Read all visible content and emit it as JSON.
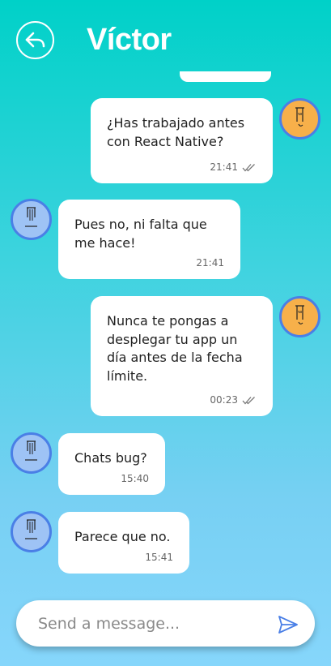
{
  "header": {
    "title": "Víctor",
    "back_icon": "back-arrow-icon"
  },
  "colors": {
    "accent": "#4a7fe6",
    "me_avatar": "#f7b04a",
    "them_avatar": "#9ec3f5"
  },
  "messages": [
    {
      "from": "me",
      "text": "¿Has trabajado antes\ncon React Native?",
      "time": "21:41",
      "status": "double-check"
    },
    {
      "from": "them",
      "text": "Pues no, ni falta que\nme hace!",
      "time": "21:41"
    },
    {
      "from": "me",
      "text": "Nunca te pongas a\ndesplegar tu app un\ndía antes de la fecha\nlímite.",
      "time": "00:23",
      "status": "double-check"
    },
    {
      "from": "them",
      "text": "Chats bug?",
      "time": "15:40"
    },
    {
      "from": "them",
      "text": "Parece que no.",
      "time": "15:41"
    }
  ],
  "composer": {
    "placeholder": "Send a message...",
    "value": "",
    "send_icon": "send-icon"
  }
}
